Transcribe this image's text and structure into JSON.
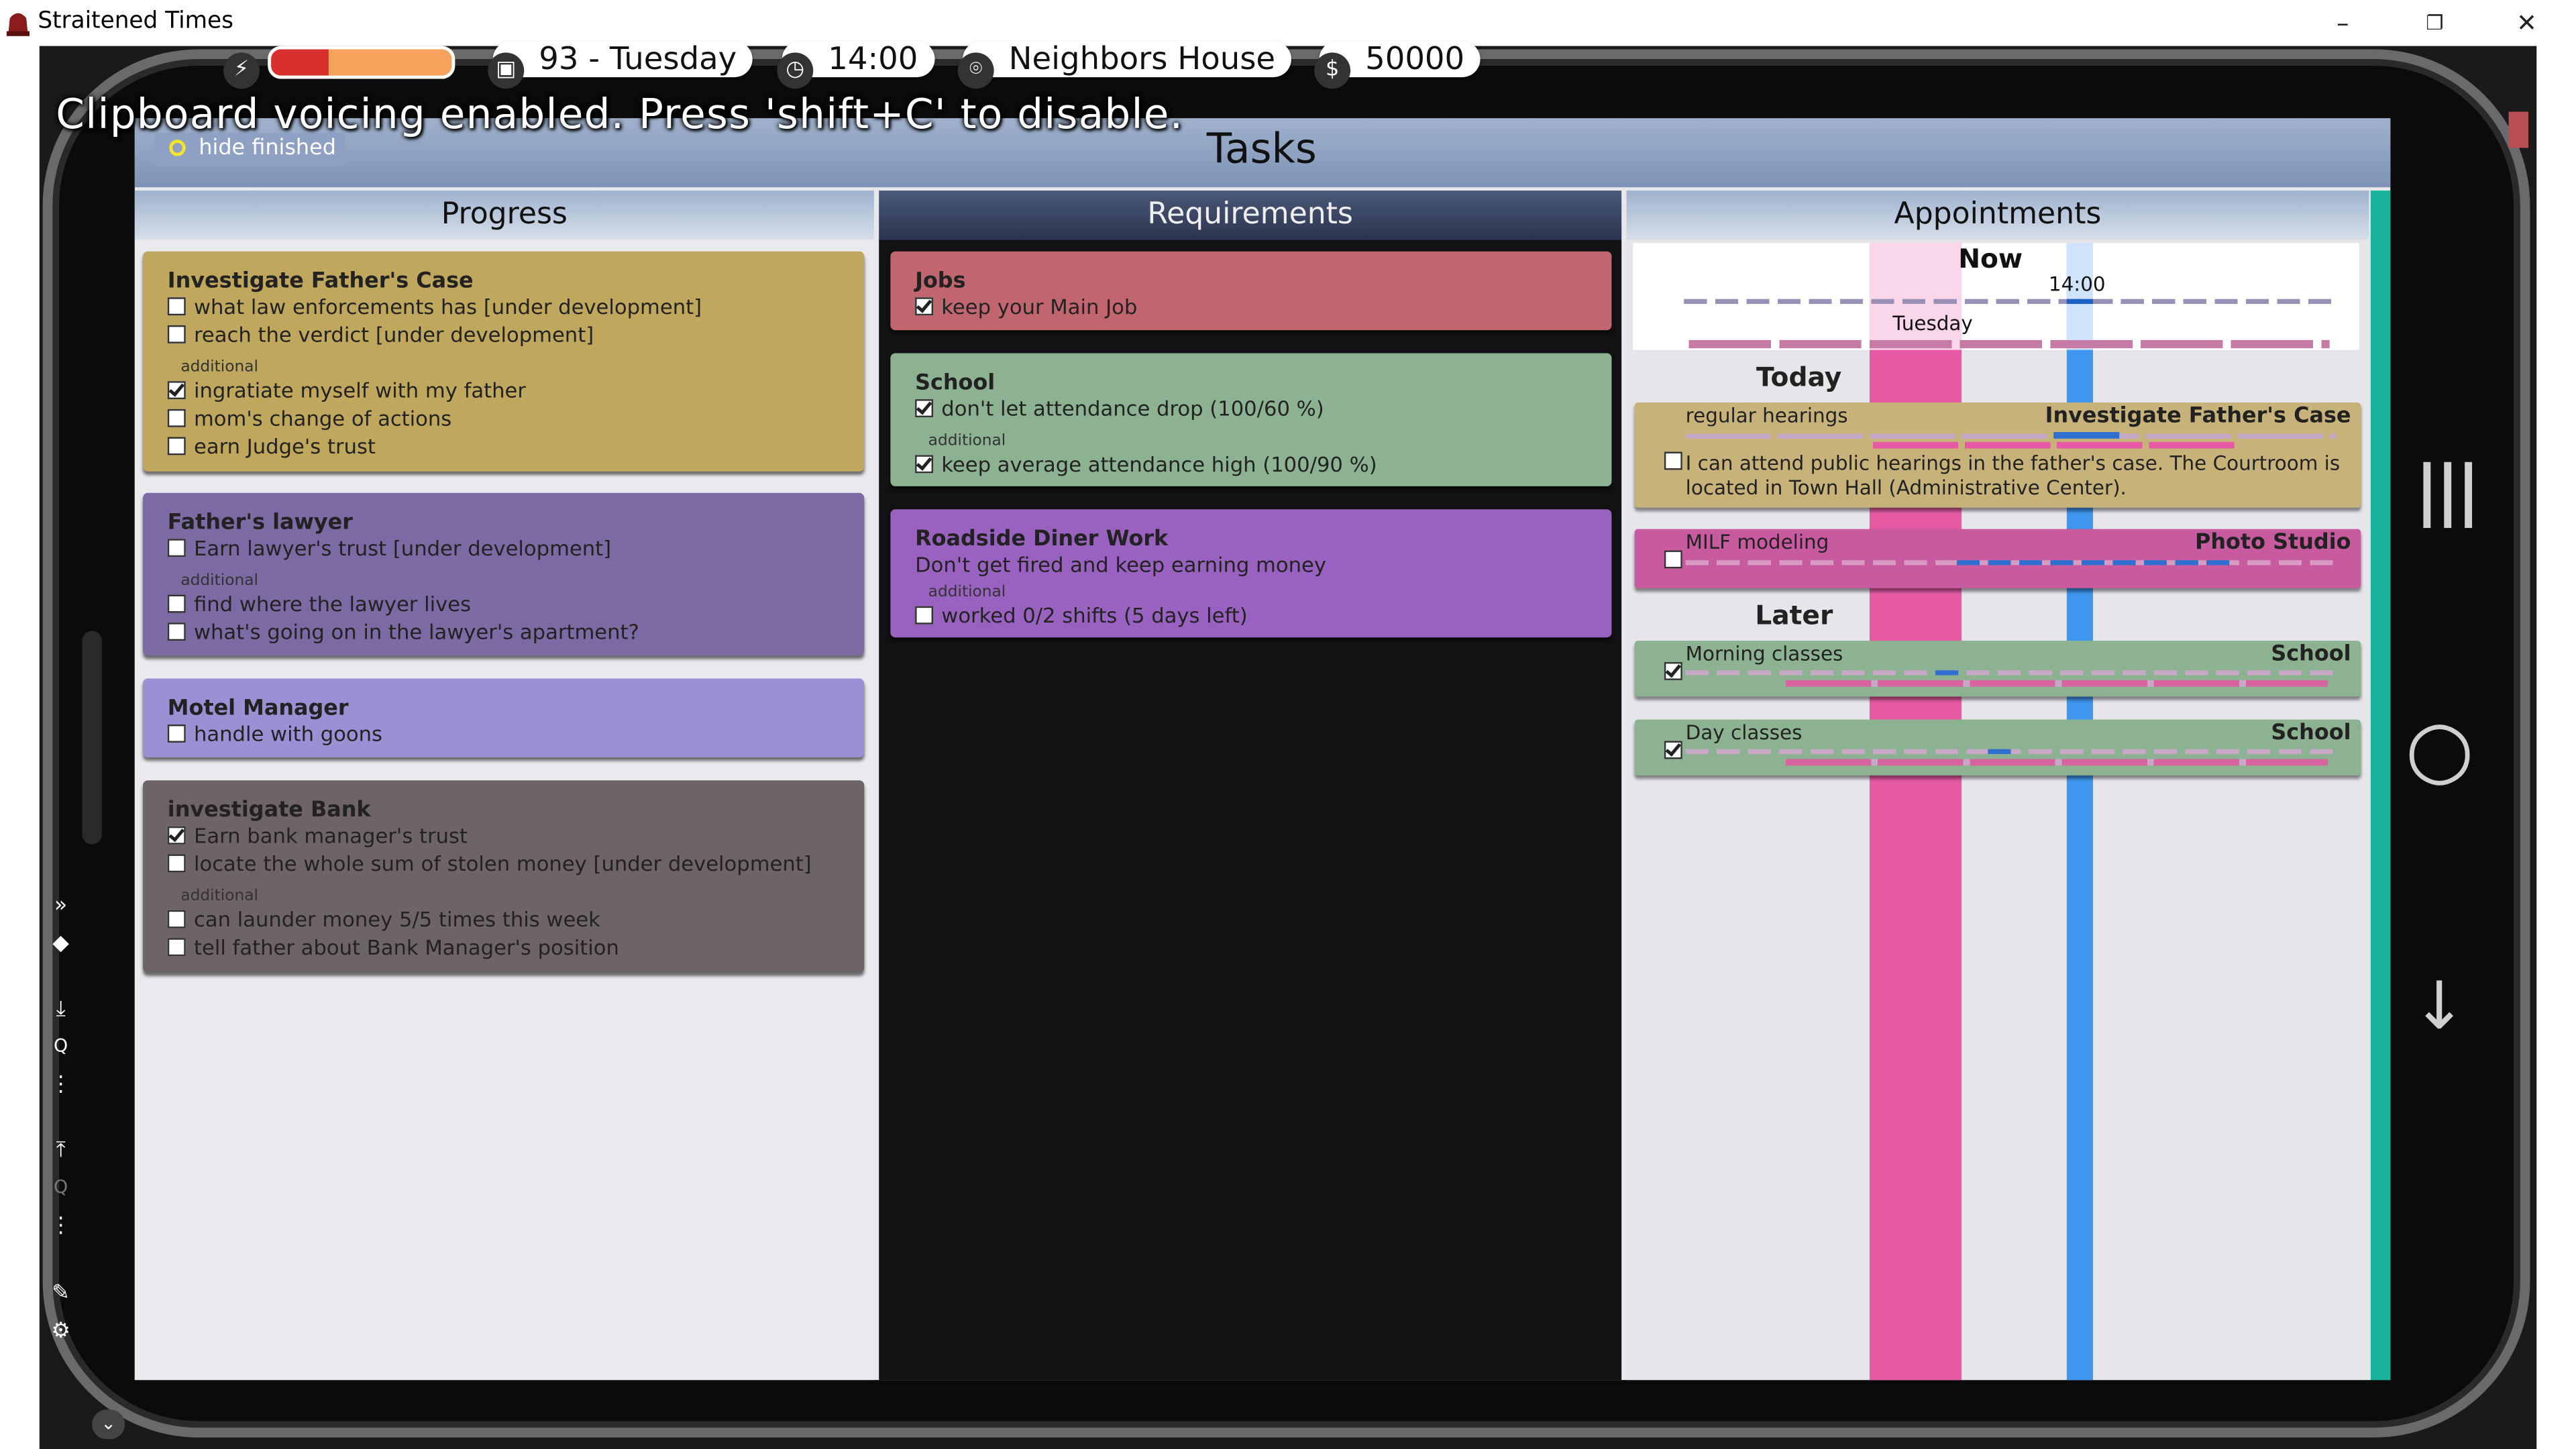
{
  "window": {
    "title": "Straitened Times",
    "minimize": "–",
    "restore": "❐",
    "close": "✕"
  },
  "status": {
    "energy_fraction": 0.32,
    "day": "93 - Tuesday",
    "time": "14:00",
    "location": "Neighbors House",
    "money": "50000",
    "icons": [
      "lightning-icon",
      "calendar-icon",
      "clock-icon",
      "location-pin-icon",
      "dollar-icon"
    ]
  },
  "notice": "Clipboard voicing enabled. Press 'shift+C' to disable.",
  "tasks": {
    "title": "Tasks",
    "hide_finished": "hide finished",
    "columns": {
      "progress": "Progress",
      "requirements": "Requirements",
      "appointments": "Appointments"
    }
  },
  "progress": [
    {
      "title": "Investigate Father's Case",
      "color": "#bfa75d",
      "items": [
        {
          "text": "what law enforcements has [under development]",
          "checked": false
        },
        {
          "text": "reach the verdict [under development]",
          "checked": false
        }
      ],
      "additional_label": "additional",
      "additional": [
        {
          "text": "ingratiate myself with my father",
          "checked": true
        },
        {
          "text": "mom's change of actions",
          "checked": false
        },
        {
          "text": "earn Judge's trust",
          "checked": false
        }
      ]
    },
    {
      "title": "Father's lawyer",
      "color": "#7b6aa4",
      "items": [
        {
          "text": "Earn lawyer's trust [under development]",
          "checked": false
        }
      ],
      "additional_label": "additional",
      "additional": [
        {
          "text": "find where the lawyer lives",
          "checked": false
        },
        {
          "text": "what's going on in the lawyer's apartment?",
          "checked": false
        }
      ]
    },
    {
      "title": "Motel Manager",
      "color": "#9a90d4",
      "items": [
        {
          "text": "handle with goons",
          "checked": false
        }
      ]
    },
    {
      "title": "investigate Bank",
      "color": "#6e6468",
      "items": [
        {
          "text": "Earn bank manager's trust",
          "checked": true
        },
        {
          "text": "locate the whole sum of stolen money [under development]",
          "checked": false
        }
      ],
      "additional_label": "additional",
      "additional": [
        {
          "text": "can launder money 5/5 times this week",
          "checked": false
        },
        {
          "text": "tell father about Bank Manager's position",
          "checked": false
        }
      ]
    }
  ],
  "requirements": [
    {
      "title": "Jobs",
      "color": "#c1666f",
      "items": [
        {
          "text": "keep your Main Job",
          "checked": true
        }
      ]
    },
    {
      "title": "School",
      "color": "#8db291",
      "items": [
        {
          "text": "don't let attendance drop (100/60 %)",
          "checked": true
        }
      ],
      "additional_label": "additional",
      "additional": [
        {
          "text": "keep average attendance high (100/90 %)",
          "checked": true
        }
      ]
    },
    {
      "title": "Roadside Diner Work",
      "color": "#9a62c0",
      "subtitle": "Don't get fired and keep earning money",
      "additional_label": "additional",
      "additional": [
        {
          "text": "worked 0/2 shifts (5 days left)",
          "checked": false
        }
      ]
    }
  ],
  "appointments": {
    "now_label": "Now",
    "now_time": "14:00",
    "now_day": "Tuesday",
    "today_label": "Today",
    "later_label": "Later",
    "colors": {
      "pink": "#e65aa3",
      "blue": "#3e96ee",
      "teal": "#17b39a"
    },
    "today": [
      {
        "name": "regular hearings",
        "location": "Investigate Father's Case",
        "description": "I can attend public hearings in the father's case. The Courtroom is located in Town Hall (Administrative Center).",
        "checked": false,
        "color": "#c7b379"
      },
      {
        "name": "MILF modeling",
        "location": "Photo Studio",
        "checked": false,
        "color": "#c85aa0"
      }
    ],
    "later": [
      {
        "name": "Morning classes",
        "location": "School",
        "checked": true,
        "color": "#8db291"
      },
      {
        "name": "Day classes",
        "location": "School",
        "checked": true,
        "color": "#8db291"
      }
    ]
  },
  "phone_nav": {
    "menu": "|||",
    "home": "○",
    "back": "↓"
  }
}
